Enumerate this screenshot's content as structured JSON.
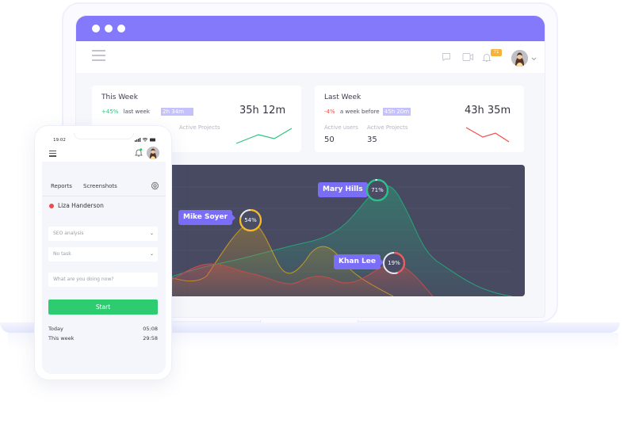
{
  "laptop": {
    "titlebar": {
      "dots": 3,
      "color": "#8479fa"
    },
    "appbar": {
      "icons": [
        "menu-icon",
        "chat-icon",
        "video-icon",
        "bell-icon",
        "avatar",
        "chevron-down-icon"
      ],
      "notification_count": "71"
    },
    "this_week": {
      "title": "This Week",
      "change": "+45%",
      "compare_label": "last week",
      "compare_value": "2h 34m",
      "total": "35h 12m",
      "active_projects_label": "Active Projects",
      "trend_color": "#2ec27e"
    },
    "last_week": {
      "title": "Last Week",
      "change": "-4%",
      "compare_label": "a week before",
      "compare_value": "45h 20m",
      "total": "43h 35m",
      "active_users_label": "Active users",
      "active_users": "50",
      "active_projects_label": "Active Projects",
      "active_projects": "35",
      "trend_color": "#ef4d4d"
    },
    "chart": {
      "people": [
        {
          "name": "Mike Soyer",
          "percent": "54%",
          "fraction": 0.54,
          "color": "#f5b921"
        },
        {
          "name": "Mary Hills",
          "percent": "71%",
          "fraction": 0.71,
          "color": "#27c28a"
        },
        {
          "name": "Khan Lee",
          "percent": "19%",
          "fraction": 0.19,
          "color": "#ef5a5a"
        }
      ]
    }
  },
  "phone": {
    "time": "19:02",
    "tabs": [
      "Reports",
      "Screenshots"
    ],
    "user": "Liza Handerson",
    "project_select": "SEO analysis",
    "task_select": "No task",
    "activity_placeholder": "What are you doing now?",
    "start_label": "Start",
    "today_label": "Today",
    "today_value": "05:08",
    "week_label": "This week",
    "week_value": "29:58"
  }
}
